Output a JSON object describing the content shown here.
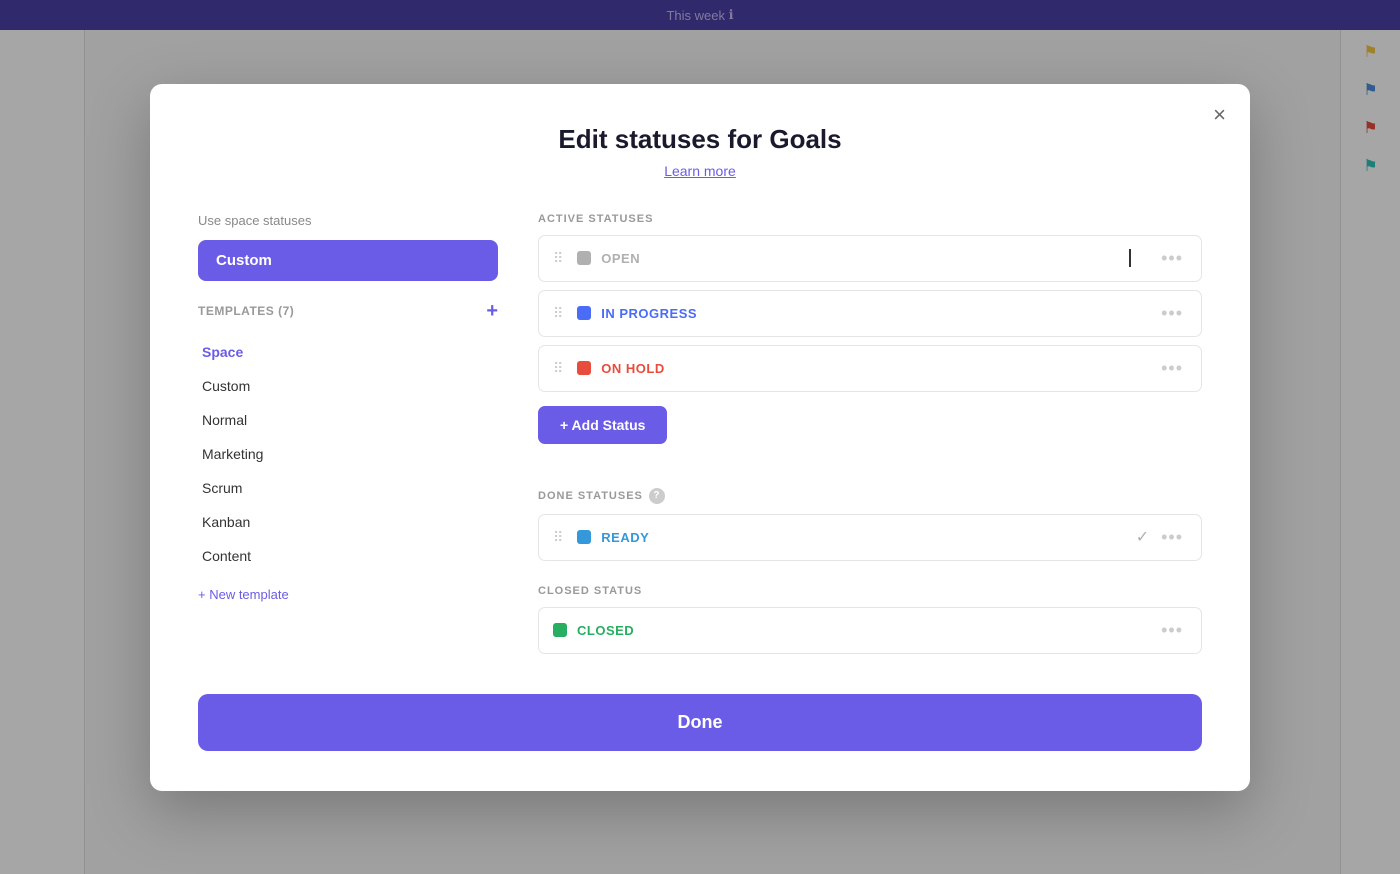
{
  "app": {
    "topbar_title": "This week",
    "info_icon": "ℹ"
  },
  "modal": {
    "title": "Edit statuses for Goals",
    "subtitle": "Learn more",
    "close_label": "×",
    "done_label": "Done"
  },
  "left_panel": {
    "use_space_label": "Use space statuses",
    "custom_btn_label": "Custom",
    "templates_label": "TEMPLATES (7)",
    "templates_add": "+",
    "templates": [
      {
        "name": "Space",
        "active": true
      },
      {
        "name": "Custom",
        "active": false
      },
      {
        "name": "Normal",
        "active": false
      },
      {
        "name": "Marketing",
        "active": false
      },
      {
        "name": "Scrum",
        "active": false
      },
      {
        "name": "Kanban",
        "active": false
      },
      {
        "name": "Content",
        "active": false
      }
    ],
    "new_template_label": "+ New template"
  },
  "right_panel": {
    "active_section_label": "ACTIVE STATUSES",
    "done_section_label": "DONE STATUSES",
    "closed_section_label": "CLOSED STATUS",
    "help_icon": "?",
    "active_statuses": [
      {
        "name": "OPEN",
        "color": "gray",
        "dot_class": "gray",
        "text_class": "gray"
      },
      {
        "name": "IN PROGRESS",
        "color": "blue",
        "dot_class": "blue",
        "text_class": "blue-text"
      },
      {
        "name": "ON HOLD",
        "color": "red",
        "dot_class": "red",
        "text_class": "red-text"
      }
    ],
    "add_status_label": "+ Add Status",
    "done_statuses": [
      {
        "name": "READY",
        "color": "cyan",
        "dot_class": "cyan",
        "text_class": "cyan-text",
        "has_check": true
      }
    ],
    "closed_statuses": [
      {
        "name": "CLOSED",
        "color": "green",
        "dot_class": "green",
        "text_class": "green-text"
      }
    ]
  },
  "flags": [
    {
      "color": "yellow",
      "symbol": "⚑"
    },
    {
      "color": "blue",
      "symbol": "⚑"
    },
    {
      "color": "red",
      "symbol": "⚑"
    },
    {
      "color": "teal",
      "symbol": "⚑"
    }
  ]
}
